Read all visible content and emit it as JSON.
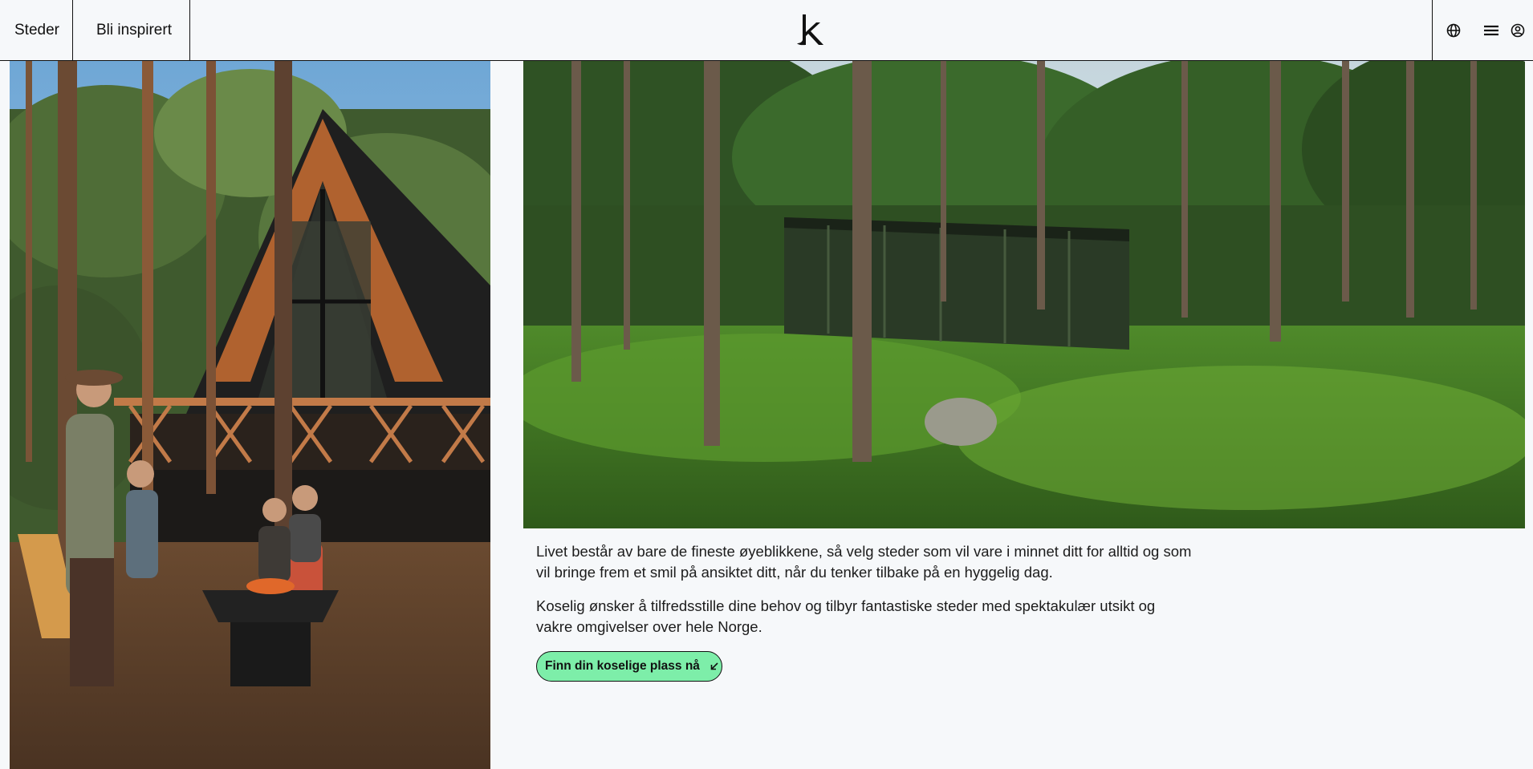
{
  "nav": {
    "left_items": [
      {
        "label": "Steder"
      },
      {
        "label": "Bli inspirert"
      }
    ],
    "logo_icon": "koselig-k-logo",
    "right_icons": [
      "globe-icon",
      "menu-icon",
      "user-icon"
    ]
  },
  "images": {
    "left": "a-frame-cabin-family-campfire",
    "right": "mirror-cabin-in-forest"
  },
  "content": {
    "paragraph_1": "Livet består av bare de fineste øyeblikkene, så velg steder som vil vare i minnet ditt for alltid og som vil bringe frem et smil på ansiktet ditt, når du tenker tilbake på en hyggelig dag.",
    "paragraph_2": "Koselig ønsker å tilfredsstille dine behov og tilbyr fantastiske steder med spektakulær utsikt og vakre omgivelser over hele Norge.",
    "cta_label": "Finn din koselige plass nå"
  },
  "colors": {
    "background": "#f6f8fa",
    "cta": "#7deea9",
    "border": "#111111"
  }
}
